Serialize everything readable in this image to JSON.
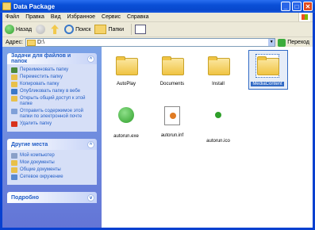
{
  "window": {
    "title": "Data Package"
  },
  "menu": [
    "Файл",
    "Правка",
    "Вид",
    "Избранное",
    "Сервис",
    "Справка"
  ],
  "toolbar": {
    "back": "Назад",
    "search": "Поиск",
    "folders": "Папки"
  },
  "address": {
    "label": "Адрес:",
    "value": "D:\\",
    "go": "Переход"
  },
  "tasks": {
    "title": "Задачи для файлов и папок",
    "items": [
      "Переименовать папку",
      "Переместить папку",
      "Копировать папку",
      "Опубликовать папку в вебе",
      "Открыть общий доступ к этой папке",
      "Отправить содержимое этой папки по электронной почте",
      "Удалить папку"
    ]
  },
  "places": {
    "title": "Другие места",
    "items": [
      "Мой компьютер",
      "Мои документы",
      "Общие документы",
      "Сетевое окружение"
    ]
  },
  "details": {
    "title": "Подробно"
  },
  "files": [
    {
      "name": "AutoPlay"
    },
    {
      "name": "Documents"
    },
    {
      "name": "Install"
    },
    {
      "name": "MediaContent"
    },
    {
      "name": "autorun.exe"
    },
    {
      "name": "autorun.inf"
    },
    {
      "name": "autorun.ico"
    }
  ],
  "colors": {
    "titlebar": "#0a4fd6",
    "sidebar": "#7ba2e7",
    "selection": "#316ac5"
  }
}
